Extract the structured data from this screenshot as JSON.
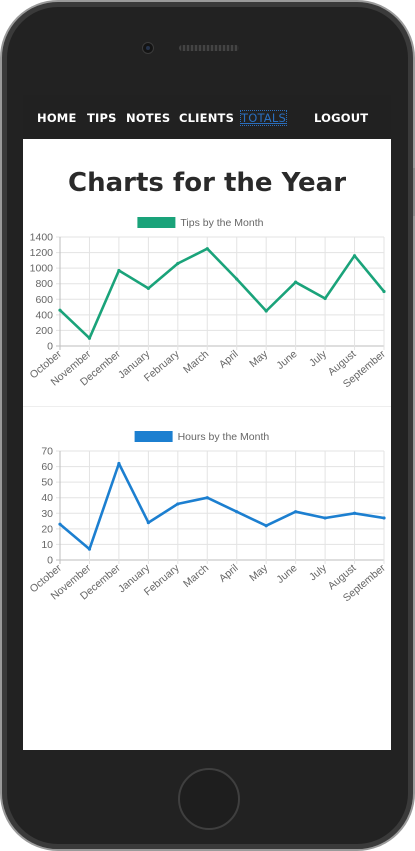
{
  "nav": {
    "items": [
      {
        "label": "HOME"
      },
      {
        "label": "TIPS"
      },
      {
        "label": "NOTES"
      },
      {
        "label": "CLIENTS"
      },
      {
        "label": "TOTALS",
        "active": true
      },
      {
        "label": "LOGOUT"
      }
    ],
    "active_color": "#2a6fbf",
    "bar_color": "#212121"
  },
  "page": {
    "title": "Charts for the Year"
  },
  "chart_data": [
    {
      "type": "line",
      "categories": [
        "October",
        "November",
        "December",
        "January",
        "February",
        "March",
        "April",
        "May",
        "June",
        "July",
        "August",
        "September"
      ],
      "series": [
        {
          "name": "Tips by the Month",
          "color": "#1aa37a",
          "values": [
            460,
            100,
            970,
            740,
            1060,
            1250,
            860,
            450,
            820,
            610,
            1160,
            700
          ]
        }
      ],
      "ylim": [
        0,
        1400
      ],
      "yticks": [
        0,
        200,
        400,
        600,
        800,
        1000,
        1200,
        1400
      ],
      "grid": true,
      "legend": "top-center"
    },
    {
      "type": "line",
      "categories": [
        "October",
        "November",
        "December",
        "January",
        "February",
        "March",
        "April",
        "May",
        "June",
        "July",
        "August",
        "September"
      ],
      "series": [
        {
          "name": "Hours by the Month",
          "color": "#1c7fd0",
          "values": [
            23,
            7,
            62,
            24,
            36,
            40,
            31,
            22,
            31,
            27,
            30,
            27
          ]
        }
      ],
      "ylim": [
        0,
        70
      ],
      "yticks": [
        0,
        10,
        20,
        30,
        40,
        50,
        60,
        70
      ],
      "grid": true,
      "legend": "top-center"
    }
  ]
}
